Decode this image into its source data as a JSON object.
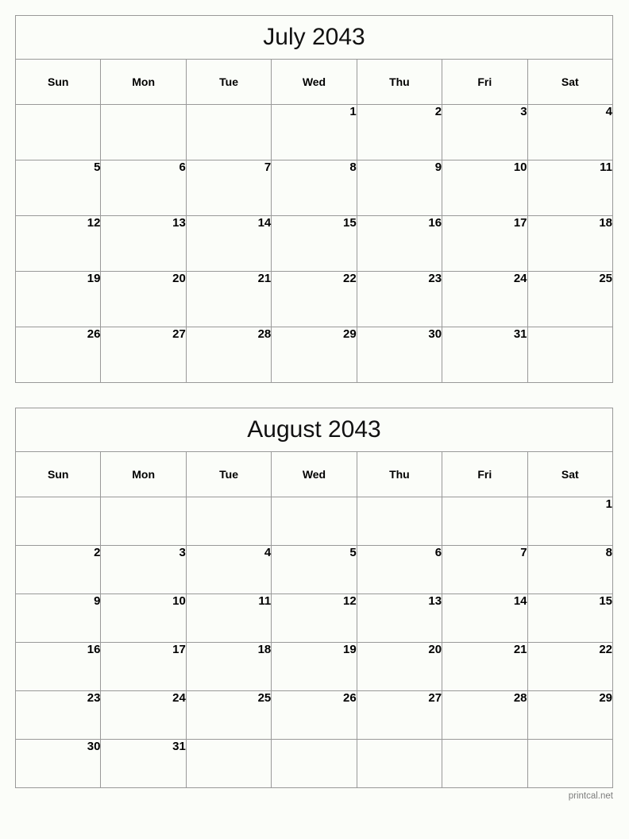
{
  "page": {
    "background_color": "#fbfdf9",
    "border_color": "#999999",
    "footer_text": "printcal.net",
    "footer_color": "#7d7d7d"
  },
  "months": [
    {
      "title": "July 2043",
      "weekdays": [
        "Sun",
        "Mon",
        "Tue",
        "Wed",
        "Thu",
        "Fri",
        "Sat"
      ],
      "weeks": [
        [
          "",
          "",
          "",
          "1",
          "2",
          "3",
          "4"
        ],
        [
          "5",
          "6",
          "7",
          "8",
          "9",
          "10",
          "11"
        ],
        [
          "12",
          "13",
          "14",
          "15",
          "16",
          "17",
          "18"
        ],
        [
          "19",
          "20",
          "21",
          "22",
          "23",
          "24",
          "25"
        ],
        [
          "26",
          "27",
          "28",
          "29",
          "30",
          "31",
          ""
        ]
      ]
    },
    {
      "title": "August 2043",
      "weekdays": [
        "Sun",
        "Mon",
        "Tue",
        "Wed",
        "Thu",
        "Fri",
        "Sat"
      ],
      "weeks": [
        [
          "",
          "",
          "",
          "",
          "",
          "",
          "1"
        ],
        [
          "2",
          "3",
          "4",
          "5",
          "6",
          "7",
          "8"
        ],
        [
          "9",
          "10",
          "11",
          "12",
          "13",
          "14",
          "15"
        ],
        [
          "16",
          "17",
          "18",
          "19",
          "20",
          "21",
          "22"
        ],
        [
          "23",
          "24",
          "25",
          "26",
          "27",
          "28",
          "29"
        ],
        [
          "30",
          "31",
          "",
          "",
          "",
          "",
          ""
        ]
      ]
    }
  ]
}
